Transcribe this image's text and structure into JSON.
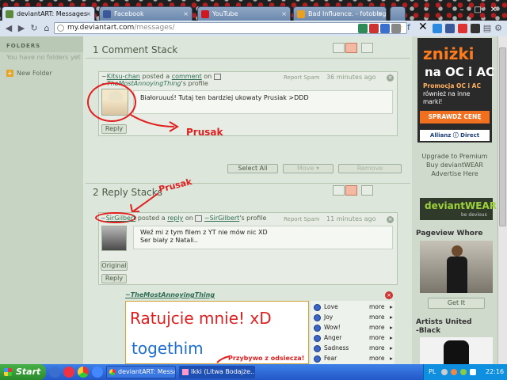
{
  "browser": {
    "tabs": [
      {
        "label": "deviantART: Messages",
        "icon_color": "#5b8a3a",
        "active": true
      },
      {
        "label": "Facebook",
        "icon_color": "#3b5998",
        "active": false
      },
      {
        "label": "YouTube",
        "icon_color": "#cc181e",
        "active": false
      },
      {
        "label": "Bad Influence. - fotoblog t...",
        "icon_color": "#e8a020",
        "active": false
      }
    ],
    "url": "my.deviantart.com",
    "url_path": "/messages/",
    "window_controls": [
      "–",
      "□",
      "✕"
    ]
  },
  "sidebar": {
    "header": "FOLDERS",
    "empty_text": "You have no folders yet",
    "new_folder": "New Folder"
  },
  "comments_section": {
    "title": "1 Comment Stack",
    "comment": {
      "prefix": "~",
      "author": "Kitsu-chan",
      "posted_text": "posted a",
      "link": "comment",
      "on_text": "on",
      "target": "~TheMostAnnoyingThing",
      "target_suffix": "'s profile",
      "report": "Report Spam",
      "time": "36 minutes ago",
      "text": "Białoruuuś! Tutaj ten bardziej ukowaty Prusiak >DDD",
      "reply": "Reply"
    },
    "buttons": {
      "select_all": "Select All",
      "move": "Move ▾",
      "remove": "Remove"
    },
    "annotation": "Prusak"
  },
  "replies_section": {
    "title": "2 Reply Stacks",
    "annotation": "Prusak",
    "reply": {
      "prefix": "~",
      "author": "SirGilbert",
      "posted_text": "posted a",
      "link": "reply",
      "on_text": "on",
      "target": "~SirGilbert",
      "target_suffix": "'s profile",
      "report": "Report Spam",
      "time": "11 minutes ago",
      "text_line1": "Weź mi z tym filem z YT nie mów nic XD",
      "text_line2": "Ser biały z Natali..",
      "original": "Original",
      "reply": "Reply"
    },
    "popup": {
      "header": "~TheMostAnnoyingThing",
      "handwritten1": "Ratujcie mnie! xD",
      "handwritten2": "togethim",
      "annotation": "Przybywo z odsiecza!",
      "emotions": [
        {
          "label": "Love",
          "more": "more"
        },
        {
          "label": "Joy",
          "more": "more"
        },
        {
          "label": "Wow!",
          "more": "more"
        },
        {
          "label": "Anger",
          "more": "more"
        },
        {
          "label": "Sadness",
          "more": "more"
        },
        {
          "label": "Fear",
          "more": "more"
        }
      ]
    }
  },
  "right_column": {
    "ad_title_line1": "zniżki",
    "ad_title_line2": "na OC i AC",
    "ad_promo_line1": "Promocja OC i AC",
    "ad_promo_line2": "również na inne",
    "ad_promo_line3": "marki!",
    "ad_button": "SPRAWDŹ CENĘ",
    "ad_brand": "Allianz ⓘ Direct",
    "upgrade": "Upgrade to Premium",
    "wear": "Buy deviantWEAR",
    "advertise": "Advertise Here",
    "dw_logo": "deviantWEAR",
    "dw_tag": "be devious",
    "pageview_title": "Pageview Whore",
    "get_it": "Get It",
    "artists_title_line1": "Artists United",
    "artists_title_line2": "-Black"
  },
  "taskbar": {
    "start": "Start",
    "tasks": [
      {
        "label": "deviantART: Messag...",
        "active": false
      },
      {
        "label": "Ikki (Litwa Bodajże.......",
        "active": true
      }
    ],
    "lang": "PL",
    "clock": "22:16"
  },
  "colors": {
    "accent_red": "#e02020",
    "link_green": "#2f6e55",
    "panel_bg": "#dde6da",
    "ad_orange": "#f07020"
  }
}
